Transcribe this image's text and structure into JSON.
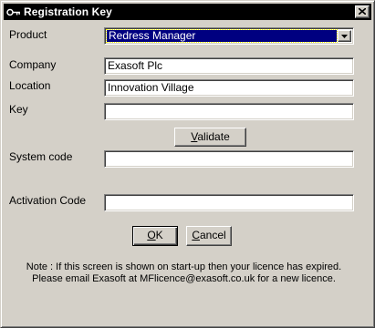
{
  "window": {
    "title": "Registration Key",
    "close_label": "×"
  },
  "fields": {
    "product": {
      "label": "Product",
      "value": "Redress Manager"
    },
    "company": {
      "label": "Company",
      "value": "Exasoft Plc"
    },
    "location": {
      "label": "Location",
      "value": "Innovation Village"
    },
    "key": {
      "label": "Key",
      "value": ""
    },
    "system_code": {
      "label": "System code",
      "value": ""
    },
    "activation_code": {
      "label": "Activation Code",
      "value": ""
    }
  },
  "buttons": {
    "validate": {
      "mnemonic": "V",
      "rest": "alidate"
    },
    "ok": {
      "mnemonic": "O",
      "rest": "K"
    },
    "cancel": {
      "mnemonic": "C",
      "rest": "ancel"
    }
  },
  "note": {
    "line1": "Note : If this screen is shown on start-up then your licence has expired.",
    "line2": "Please email Exasoft at MFlicence@exasoft.co.uk for a new licence."
  },
  "icons": {
    "title": "key-icon",
    "dropdown": "chevron-down-icon"
  }
}
